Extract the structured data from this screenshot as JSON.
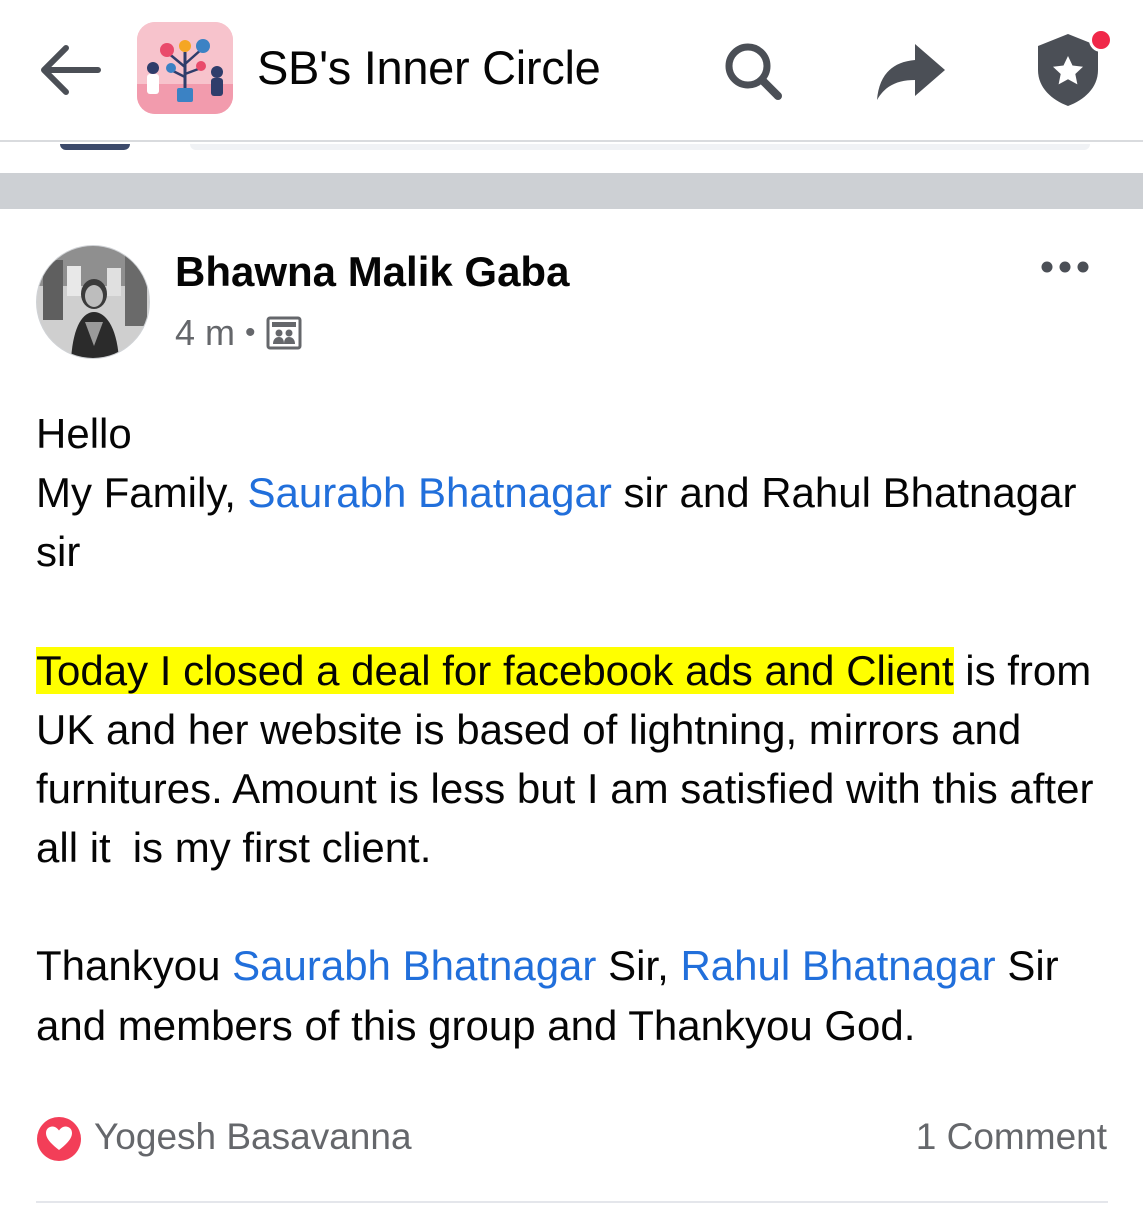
{
  "header": {
    "title": "SB's Inner Circle",
    "back_icon": "arrow-left-icon",
    "search_icon": "search-icon",
    "share_icon": "share-icon",
    "badge_icon": "shield-star-icon",
    "has_notification": true
  },
  "post": {
    "author": "Bhawna Malik Gaba",
    "time": "4 m",
    "meta_separator": "•",
    "audience_icon": "group-icon",
    "more_icon": "more-dots-icon",
    "body": {
      "greeting": "Hello",
      "line2_prefix": "My Family, ",
      "mention1": "Saurabh Bhatnagar",
      "line2_suffix": " sir and Rahul Bhatnagar sir",
      "highlighted": "Today I closed a deal for facebook ads and Client",
      "paragraph2_rest": " is from UK and her website is based of lightning, mirrors and furnitures. Amount is less but I am satisfied with this after all it",
      "paragraph2_end": "is my first client.",
      "thanks_prefix": "Thankyou ",
      "mention2": "Saurabh Bhatnagar",
      "thanks_mid": " Sir, ",
      "mention3": "Rahul Bhatnagar",
      "thanks_suffix": " Sir and members of this group and Thankyou God."
    },
    "reaction_icon": "love-reaction-icon",
    "reactor": "Yogesh Basavanna",
    "comments": "1 Comment"
  },
  "colors": {
    "mention": "#216fdb",
    "highlight": "#ffff00",
    "meta": "#65676b",
    "love": "#f33e58",
    "notification": "#f02849"
  }
}
